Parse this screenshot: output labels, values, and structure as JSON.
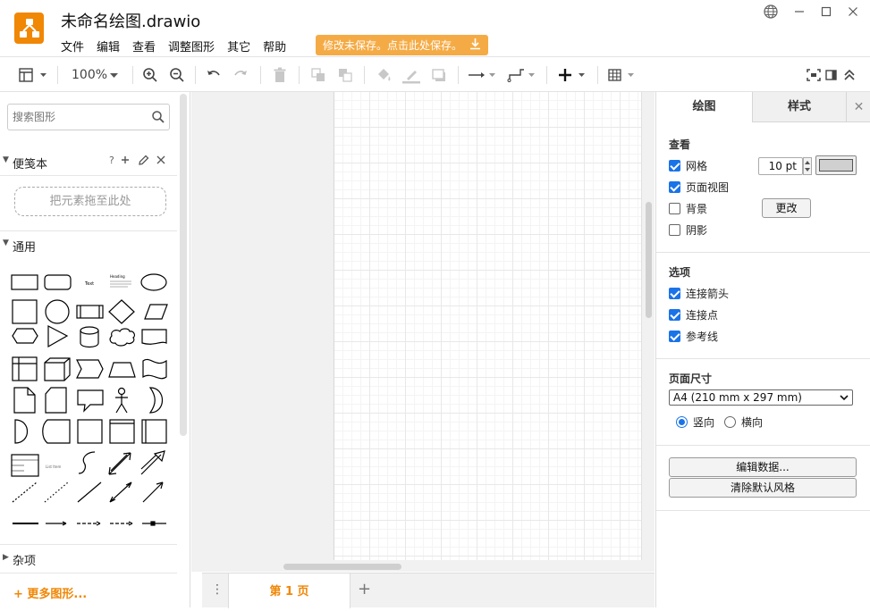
{
  "app": {
    "title": "未命名绘图.drawio",
    "logo_color": "#f08705",
    "accent": "#f08705",
    "menu": [
      "文件",
      "编辑",
      "查看",
      "调整图形",
      "其它",
      "帮助"
    ],
    "save_notice": "修改未保存。点击此处保存。",
    "window_controls": [
      "globe-icon",
      "minimize-icon",
      "maximize-icon",
      "close-icon"
    ]
  },
  "toolbar": {
    "zoom": "100%",
    "icons": [
      "format-panel-icon",
      "zoom-in-icon",
      "zoom-out-icon",
      "undo-icon",
      "redo-icon",
      "delete-icon",
      "to-front-icon",
      "to-back-icon",
      "fill-color-icon",
      "line-color-icon",
      "shadow-icon",
      "connection-icon",
      "waypoints-icon",
      "insert-icon",
      "table-icon",
      "fullscreen-icon",
      "format-icon",
      "collapse-icon"
    ]
  },
  "sidebar": {
    "search_placeholder": "搜索图形",
    "scratchpad": {
      "title": "便笺本",
      "help": "?",
      "drop_text": "把元素拖至此处"
    },
    "general_title": "通用",
    "misc_title": "杂项",
    "more_shapes": "+ 更多图形..."
  },
  "canvas": {
    "page_tab": "第 1 页",
    "add_page": "+"
  },
  "format_panel": {
    "tabs": [
      "绘图",
      "样式"
    ],
    "view": {
      "title": "查看",
      "grid": {
        "label": "网格",
        "checked": true,
        "size": "10 pt"
      },
      "page_view": {
        "label": "页面视图",
        "checked": true
      },
      "background": {
        "label": "背景",
        "checked": false,
        "button": "更改"
      },
      "shadow": {
        "label": "阴影",
        "checked": false
      }
    },
    "options": {
      "title": "选项",
      "items": [
        {
          "label": "连接箭头",
          "checked": true
        },
        {
          "label": "连接点",
          "checked": true
        },
        {
          "label": "参考线",
          "checked": true
        }
      ]
    },
    "paper": {
      "title": "页面尺寸",
      "size": "A4 (210 mm x 297 mm)",
      "portrait": "竖向",
      "landscape": "横向",
      "orientation": "portrait"
    },
    "buttons": {
      "edit_data": "编辑数据...",
      "clear_style": "清除默认风格"
    }
  }
}
